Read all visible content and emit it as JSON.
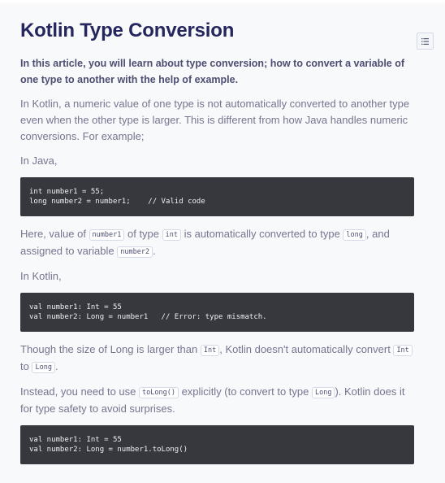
{
  "title": "Kotlin Type Conversion",
  "toc_icon": "list-icon",
  "intro": "In this article, you will learn about type conversion; how to convert a variable of one type to another with the help of example.",
  "p1": "In Kotlin, a numeric value of one type is not automatically converted to another type even when the other type is larger. This is different from how Java handles numeric conversions. For example;",
  "p2": "In Java,",
  "code1": [
    "int number1 = 55;",
    "long number2 = number1;    // Valid code"
  ],
  "p3": {
    "t1": "Here, value of ",
    "c1": "number1",
    "t2": " of type ",
    "c2": "int",
    "t3": " is automatically converted to type ",
    "c3": "long",
    "t4": ", and assigned to variable ",
    "c4": "number2",
    "t5": "."
  },
  "p4": "In Kotlin,",
  "code2": [
    "val number1: Int = 55",
    "val number2: Long = number1   // Error: type mismatch."
  ],
  "p5": {
    "t1": "Though the size of Long is larger than ",
    "c1": "Int",
    "t2": ", Kotlin doesn't automatically convert ",
    "c2": "Int",
    "t3": " to ",
    "c3": "Long",
    "t4": "."
  },
  "p6": {
    "t1": "Instead, you need to use ",
    "c1": "toLong()",
    "t2": " explicitly (to convert to type ",
    "c2": "Long",
    "t3": "). Kotlin does it for type safety to avoid surprises."
  },
  "code3": [
    "val number1: Int = 55",
    "val number2: Long = number1.toLong()"
  ]
}
